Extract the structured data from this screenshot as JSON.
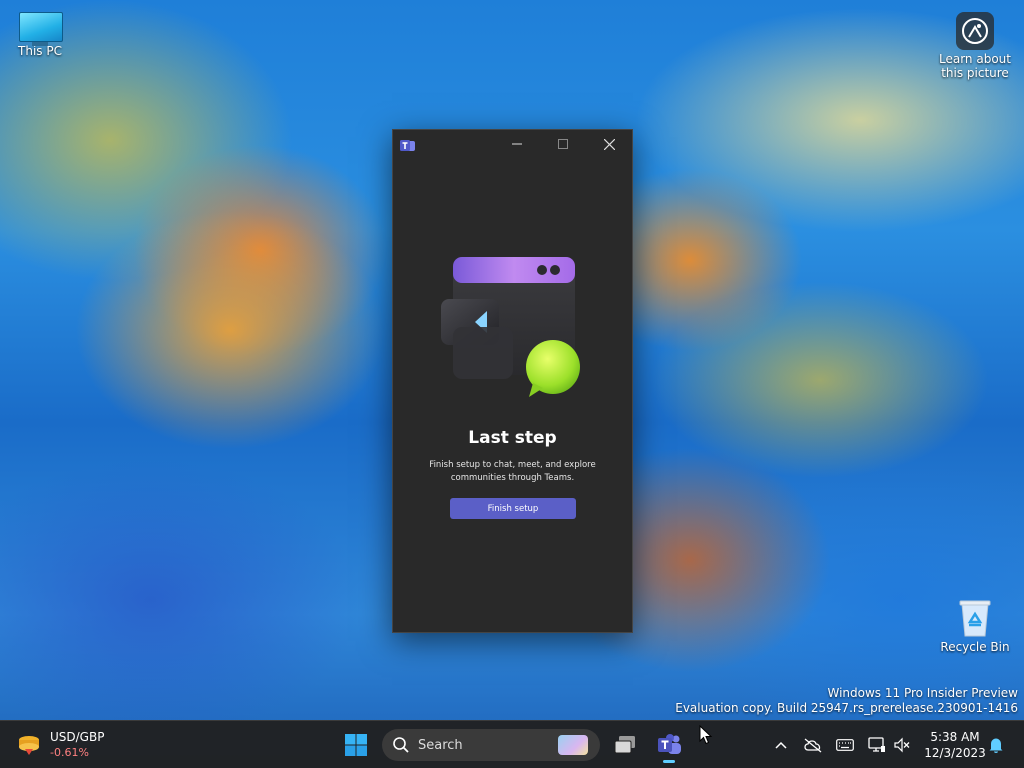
{
  "desktop": {
    "icons": [
      {
        "label": "This PC"
      },
      {
        "label": "Learn about this picture"
      },
      {
        "label": "Recycle Bin"
      }
    ],
    "watermark": {
      "line1": "Windows 11 Pro Insider Preview",
      "line2": "Evaluation copy. Build 25947.rs_prerelease.230901-1416"
    }
  },
  "teams_window": {
    "app_icon": "teams-logo",
    "heading": "Last step",
    "description": "Finish setup to chat, meet, and explore communities through Teams.",
    "button_label": "Finish setup",
    "colors": {
      "background": "#292929",
      "button": "#5b5fc7"
    }
  },
  "taskbar": {
    "widget": {
      "symbol": "USD/GBP",
      "change": "-0.61%"
    },
    "search_placeholder": "Search",
    "clock": {
      "time": "5:38 AM",
      "date": "12/3/2023"
    }
  }
}
